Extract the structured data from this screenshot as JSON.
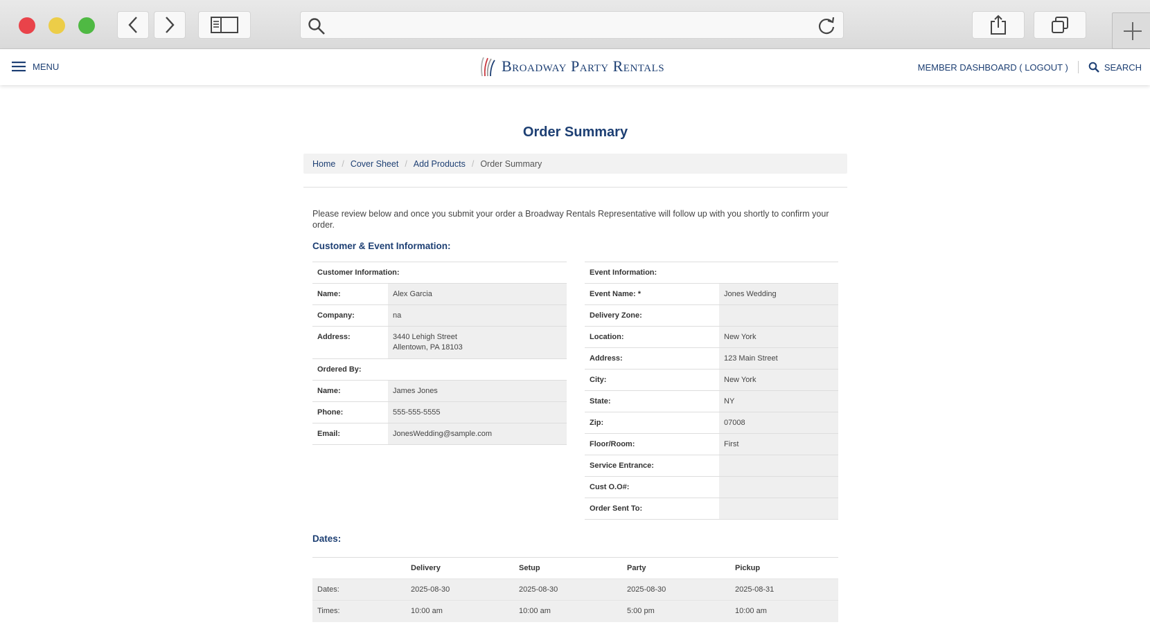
{
  "browser": {
    "icons": {
      "back": "chevron-left-icon",
      "forward": "chevron-right-icon",
      "sidebar": "sidebar-icon",
      "search": "search-icon",
      "reload": "reload-icon",
      "share": "share-icon",
      "tabs": "tabs-icon",
      "new_tab": "plus-icon"
    },
    "address_value": ""
  },
  "header": {
    "menu_label": "MENU",
    "logo_text": "Broadway Party Rentals",
    "dashboard_label": "MEMBER DASHBOARD ( LOGOUT )",
    "search_label": "SEARCH"
  },
  "page": {
    "title": "Order Summary",
    "breadcrumb": [
      "Home",
      "Cover Sheet",
      "Add Products",
      "Order Summary"
    ],
    "intro": "Please review below and once you submit your order a Broadway Rentals Representative will follow up with you shortly to confirm your order.",
    "section_title": "Customer & Event Information:"
  },
  "customer": {
    "heading": "Customer Information:",
    "name_label": "Name:",
    "name": "Alex Garcia",
    "company_label": "Company:",
    "company": "na",
    "address_label": "Address:",
    "address_line1": "3440 Lehigh Street",
    "address_line2": "Allentown, PA 18103",
    "ordered_by_heading": "Ordered By:",
    "ob_name_label": "Name:",
    "ob_name": "James Jones",
    "phone_label": "Phone:",
    "phone": "555-555-5555",
    "email_label": "Email:",
    "email": "JonesWedding@sample.com"
  },
  "event": {
    "heading": "Event Information:",
    "rows": [
      {
        "label": "Event Name: *",
        "value": "Jones Wedding"
      },
      {
        "label": "Delivery Zone:",
        "value": ""
      },
      {
        "label": "Location:",
        "value": "New York"
      },
      {
        "label": "Address:",
        "value": "123 Main Street"
      },
      {
        "label": "City:",
        "value": "New York"
      },
      {
        "label": "State:",
        "value": "NY"
      },
      {
        "label": "Zip:",
        "value": "07008"
      },
      {
        "label": "Floor/Room:",
        "value": "First"
      },
      {
        "label": "Service Entrance:",
        "value": ""
      },
      {
        "label": "Cust O.O#:",
        "value": ""
      },
      {
        "label": "Order Sent To:",
        "value": ""
      }
    ]
  },
  "dates": {
    "title": "Dates:",
    "columns": [
      "",
      "Delivery",
      "Setup",
      "Party",
      "Pickup"
    ],
    "rows": [
      {
        "label": "Dates:",
        "values": [
          "2025-08-30",
          "2025-08-30",
          "2025-08-30",
          "2025-08-31"
        ]
      },
      {
        "label": "Times:",
        "values": [
          "10:00 am",
          "10:00 am",
          "5:00 pm",
          "10:00 am"
        ]
      }
    ]
  }
}
